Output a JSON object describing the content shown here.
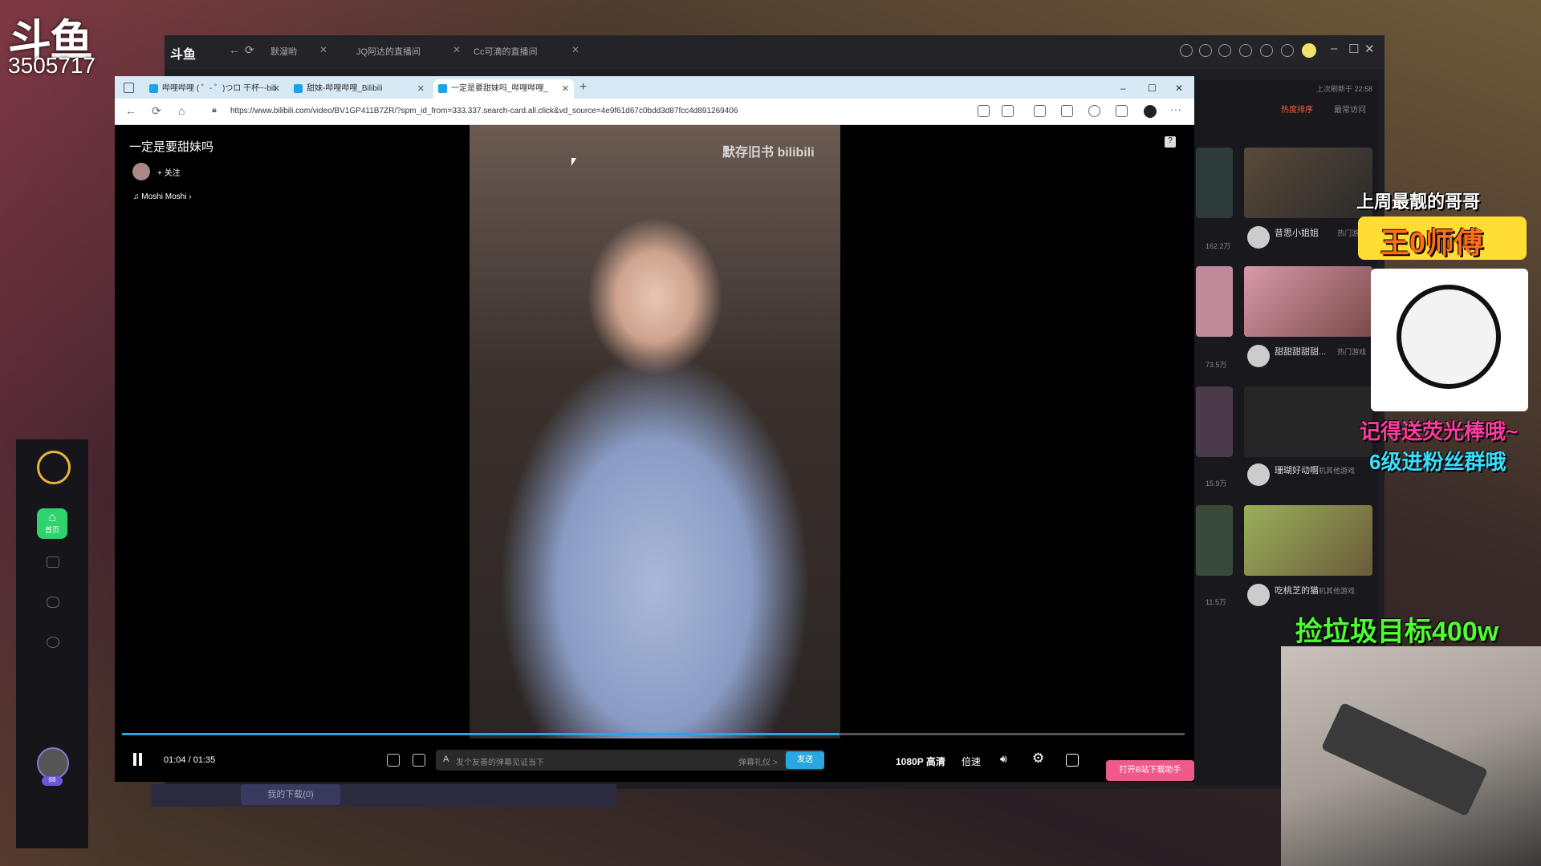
{
  "stream": {
    "platform_logo": "斗鱼",
    "room_id": "3505717",
    "overlays": {
      "line1": "上周最靓的哥哥",
      "line2": "王0师傅",
      "line3": "记得送荧光棒哦~",
      "line4": "6级进粉丝群哦",
      "line5": "捡垃圾目标400w"
    }
  },
  "douyu_app": {
    "logo": "斗鱼",
    "tabs": [
      {
        "label": "默溜哟"
      },
      {
        "label": "JQ阿达的直播间"
      },
      {
        "label": "Cc可滴的直播间"
      }
    ],
    "last_visit": "上次刷新于 22:58",
    "hot_sort": "热度排序",
    "recent": "最常访问",
    "download_label": "我的下载(0)",
    "sidebar": {
      "home_label": "首页",
      "level": "68"
    },
    "right_list": [
      {
        "title": "昔思小姐姐",
        "category": "热门游戏",
        "heat": "162.2万"
      },
      {
        "title": "甜甜甜甜甜...",
        "category": "热门游戏",
        "heat": "73.5万"
      },
      {
        "title": "珊瑚好动啊",
        "category": "主机其他游戏",
        "heat": "15.9万"
      },
      {
        "title": "吃桃芝的猫",
        "category": "主机其他游戏",
        "heat": "11.5万"
      }
    ]
  },
  "browser": {
    "tabs": [
      {
        "label": "哔哩哔哩 ( ゜- ゜)つロ 干杯~-bili"
      },
      {
        "label": "甜妹-哔哩哔哩_Bilibili"
      },
      {
        "label": "一定是要甜妹吗_哔哩哔哩_"
      }
    ],
    "url": "https://www.bilibili.com/video/BV1GP411B7ZR/?spm_id_from=333.337.search-card.all.click&vd_source=4e9f61d67c0bdd3d87fcc4d891269406"
  },
  "video": {
    "title": "一定是要甜妹吗",
    "follow_label": "+ 关注",
    "music": "Moshi Moshi",
    "watermark": "默存旧书 bilibili",
    "time": "01:04 / 01:35",
    "progress": 0.675,
    "danmu_placeholder": "发个友善的弹幕见证当下",
    "danmu_etiquette": "弹幕礼仪 >",
    "send_label": "发送",
    "quality": "1080P 高清",
    "speed": "倍速",
    "open_app": "打开B站下载助手"
  }
}
